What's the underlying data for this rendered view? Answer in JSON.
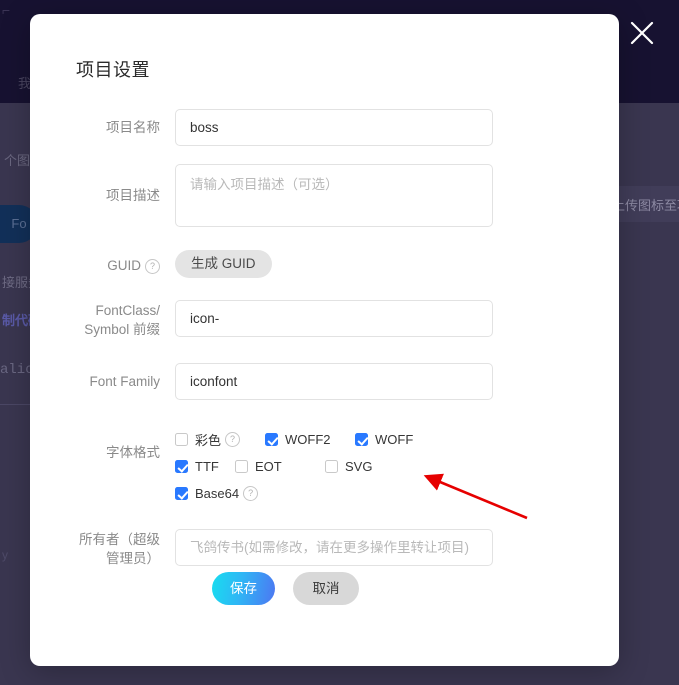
{
  "background": {
    "corner_glyph": "⌐",
    "nav_text": "我",
    "line1": "个图标",
    "pill_label": "Fo",
    "line2": "接服务",
    "line3": "制代码",
    "code_text": "alico",
    "y_text": "y",
    "right_text": "上传图标至项"
  },
  "modal": {
    "title": "项目设置",
    "close_icon": "close-icon",
    "fields": {
      "project_name": {
        "label": "项目名称",
        "value": "boss",
        "placeholder": ""
      },
      "project_desc": {
        "label": "项目描述",
        "value": "",
        "placeholder": "请输入项目描述（可选）"
      },
      "guid": {
        "label": "GUID",
        "help": "?",
        "button_label": "生成 GUID"
      },
      "prefix": {
        "label": "FontClass/\nSymbol 前缀",
        "label_line1": "FontClass/",
        "label_line2": "Symbol 前缀",
        "value": "icon-",
        "placeholder": ""
      },
      "font_family": {
        "label": "Font Family",
        "value": "iconfont",
        "placeholder": ""
      },
      "font_format": {
        "label": "字体格式"
      },
      "owner": {
        "label_line1": "所有者（超级",
        "label_line2": "管理员）",
        "value": "",
        "placeholder": "飞鸽传书(如需修改，请在更多操作里转让项目)"
      }
    },
    "checkboxes": [
      {
        "label": "彩色",
        "checked": false,
        "help": "?"
      },
      {
        "label": "WOFF2",
        "checked": true,
        "help": ""
      },
      {
        "label": "WOFF",
        "checked": true,
        "help": ""
      },
      {
        "label": "TTF",
        "checked": true,
        "help": ""
      },
      {
        "label": "EOT",
        "checked": false,
        "help": ""
      },
      {
        "label": "SVG",
        "checked": false,
        "help": ""
      },
      {
        "label": "Base64",
        "checked": true,
        "help": "?"
      }
    ],
    "buttons": {
      "save": "保存",
      "cancel": "取消"
    }
  },
  "colors": {
    "accent_checkbox": "#2979ff",
    "save_gradient_from": "#18ddef",
    "save_gradient_to": "#4d76f2",
    "backdrop": "#3a3650",
    "topbar": "#171231",
    "annotation_arrow": "#e60000"
  }
}
